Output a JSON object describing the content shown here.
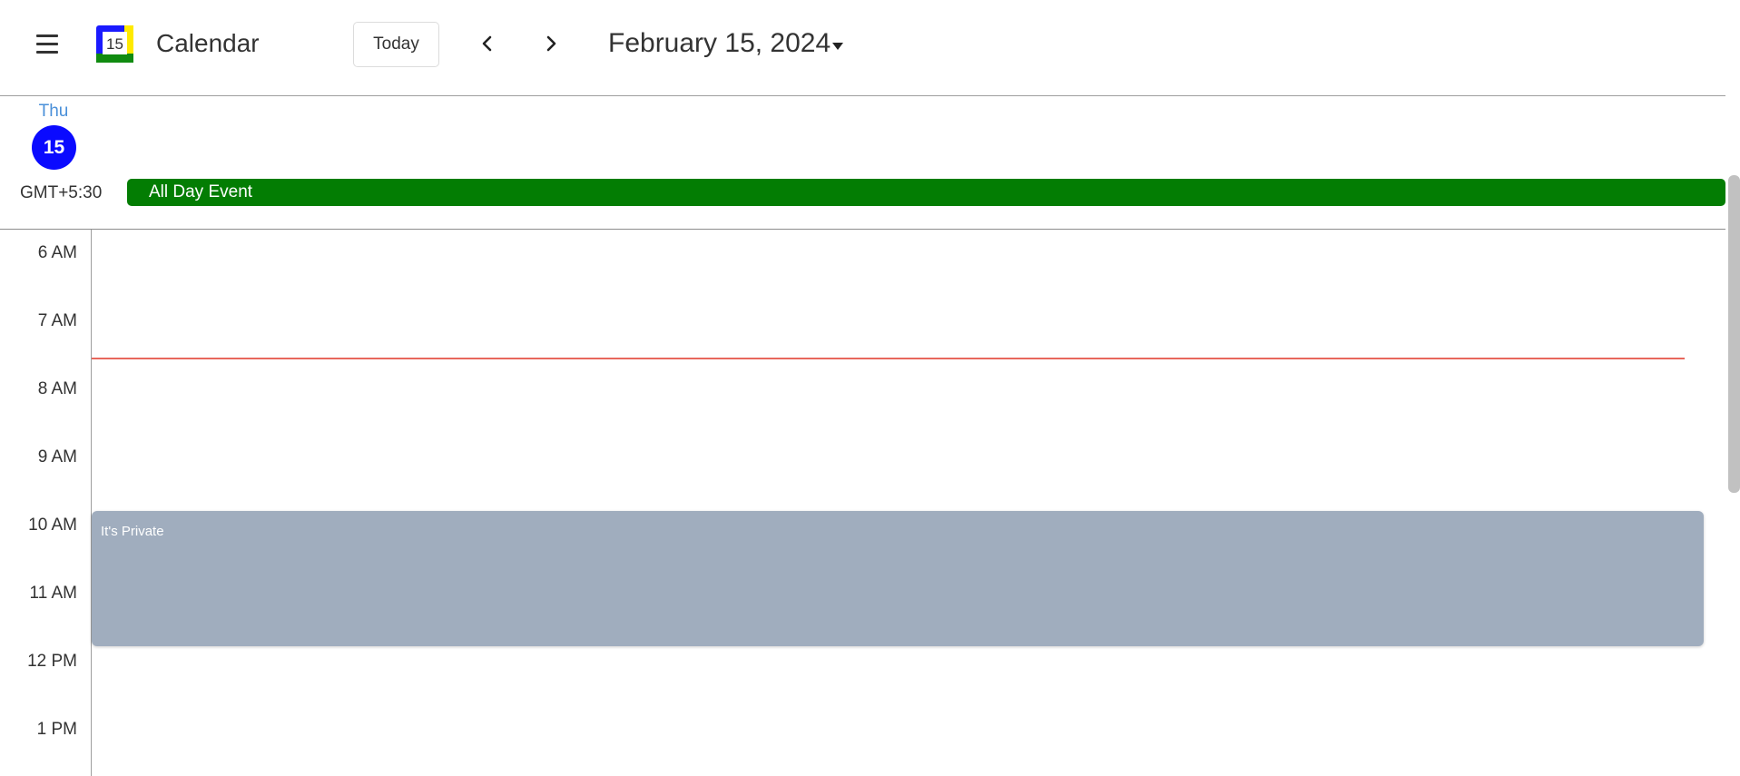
{
  "header": {
    "app_title": "Calendar",
    "logo_text": "15",
    "today_label": "Today",
    "current_date": "February 15, 2024"
  },
  "day": {
    "name": "Thu",
    "number": "15"
  },
  "timezone": "GMT+5:30",
  "all_day_event": {
    "title": "All Day Event",
    "color": "#037d03"
  },
  "hours": [
    "6 AM",
    "7 AM",
    "8 AM",
    "9 AM",
    "10 AM",
    "11 AM",
    "12 PM",
    "1 PM"
  ],
  "events": [
    {
      "title": "It's Private",
      "color": "#a0adbe"
    }
  ],
  "colors": {
    "now_indicator": "#e8675c",
    "today_circle": "#0a0aff",
    "day_name": "#4a90d9"
  }
}
